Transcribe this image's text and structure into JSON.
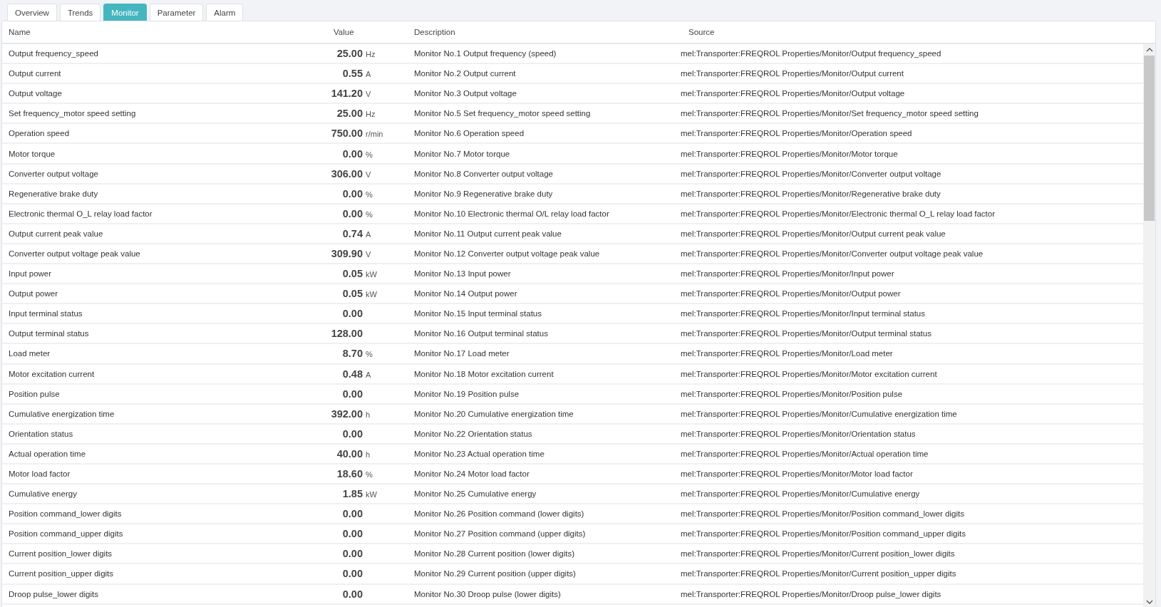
{
  "tabs": [
    {
      "label": "Overview",
      "selected": false
    },
    {
      "label": "Trends",
      "selected": false
    },
    {
      "label": "Monitor",
      "selected": true
    },
    {
      "label": "Parameter",
      "selected": false
    },
    {
      "label": "Alarm",
      "selected": false
    }
  ],
  "table": {
    "columns": [
      "Name",
      "Value",
      "Description",
      "Source"
    ],
    "rows": [
      {
        "name": "Output frequency_speed",
        "value": "25.00",
        "unit": "Hz",
        "description": "Monitor No.1 Output frequency (speed)",
        "source": "mel:Transporter:FREQROL Properties/Monitor/Output frequency_speed"
      },
      {
        "name": "Output current",
        "value": "0.55",
        "unit": "A",
        "description": "Monitor No.2 Output current",
        "source": "mel:Transporter:FREQROL Properties/Monitor/Output current"
      },
      {
        "name": "Output voltage",
        "value": "141.20",
        "unit": "V",
        "description": "Monitor No.3 Output voltage",
        "source": "mel:Transporter:FREQROL Properties/Monitor/Output voltage"
      },
      {
        "name": "Set frequency_motor speed setting",
        "value": "25.00",
        "unit": "Hz",
        "description": "Monitor No.5 Set frequency_motor speed setting",
        "source": "mel:Transporter:FREQROL Properties/Monitor/Set frequency_motor speed setting"
      },
      {
        "name": "Operation speed",
        "value": "750.00",
        "unit": "r/min",
        "description": "Monitor No.6 Operation speed",
        "source": "mel:Transporter:FREQROL Properties/Monitor/Operation speed"
      },
      {
        "name": "Motor torque",
        "value": "0.00",
        "unit": "%",
        "description": "Monitor No.7 Motor torque",
        "source": "mel:Transporter:FREQROL Properties/Monitor/Motor torque"
      },
      {
        "name": "Converter output voltage",
        "value": "306.00",
        "unit": "V",
        "description": "Monitor No.8 Converter output voltage",
        "source": "mel:Transporter:FREQROL Properties/Monitor/Converter output voltage"
      },
      {
        "name": "Regenerative brake duty",
        "value": "0.00",
        "unit": "%",
        "description": "Monitor No.9 Regenerative brake duty",
        "source": "mel:Transporter:FREQROL Properties/Monitor/Regenerative brake duty"
      },
      {
        "name": "Electronic thermal O_L relay load factor",
        "value": "0.00",
        "unit": "%",
        "description": "Monitor No.10 Electronic thermal O/L relay load factor",
        "source": "mel:Transporter:FREQROL Properties/Monitor/Electronic thermal O_L relay load factor"
      },
      {
        "name": "Output current peak value",
        "value": "0.74",
        "unit": "A",
        "description": "Monitor No.11 Output current peak value",
        "source": "mel:Transporter:FREQROL Properties/Monitor/Output current peak value"
      },
      {
        "name": "Converter output voltage peak value",
        "value": "309.90",
        "unit": "V",
        "description": "Monitor No.12 Converter output voltage peak value",
        "source": "mel:Transporter:FREQROL Properties/Monitor/Converter output voltage peak value"
      },
      {
        "name": "Input power",
        "value": "0.05",
        "unit": "kW",
        "description": "Monitor No.13 Input power",
        "source": "mel:Transporter:FREQROL Properties/Monitor/Input power"
      },
      {
        "name": "Output power",
        "value": "0.05",
        "unit": "kW",
        "description": "Monitor No.14 Output power",
        "source": "mel:Transporter:FREQROL Properties/Monitor/Output power"
      },
      {
        "name": "Input terminal status",
        "value": "0.00",
        "description": "Monitor No.15 Input terminal status",
        "source": "mel:Transporter:FREQROL Properties/Monitor/Input terminal status"
      },
      {
        "name": "Output terminal status",
        "value": "128.00",
        "description": "Monitor No.16 Output terminal status",
        "source": "mel:Transporter:FREQROL Properties/Monitor/Output terminal status"
      },
      {
        "name": "Load meter",
        "value": "8.70",
        "unit": "%",
        "description": "Monitor No.17 Load meter",
        "source": "mel:Transporter:FREQROL Properties/Monitor/Load meter"
      },
      {
        "name": "Motor excitation current",
        "value": "0.48",
        "unit": "A",
        "description": "Monitor No.18 Motor excitation current",
        "source": "mel:Transporter:FREQROL Properties/Monitor/Motor excitation current"
      },
      {
        "name": "Position pulse",
        "value": "0.00",
        "description": "Monitor No.19 Position pulse",
        "source": "mel:Transporter:FREQROL Properties/Monitor/Position pulse"
      },
      {
        "name": "Cumulative energization time",
        "value": "392.00",
        "unit": "h",
        "description": "Monitor No.20 Cumulative energization time",
        "source": "mel:Transporter:FREQROL Properties/Monitor/Cumulative energization time"
      },
      {
        "name": "Orientation status",
        "value": "0.00",
        "description": "Monitor No.22 Orientation status",
        "source": "mel:Transporter:FREQROL Properties/Monitor/Orientation status"
      },
      {
        "name": "Actual operation time",
        "value": "40.00",
        "unit": "h",
        "description": "Monitor No.23 Actual operation time",
        "source": "mel:Transporter:FREQROL Properties/Monitor/Actual operation time"
      },
      {
        "name": "Motor load factor",
        "value": "18.60",
        "unit": "%",
        "description": "Monitor No.24 Motor load factor",
        "source": "mel:Transporter:FREQROL Properties/Monitor/Motor load factor"
      },
      {
        "name": "Cumulative energy",
        "value": "1.85",
        "unit": "kW",
        "description": "Monitor No.25 Cumulative energy",
        "source": "mel:Transporter:FREQROL Properties/Monitor/Cumulative energy"
      },
      {
        "name": "Position command_lower digits",
        "value": "0.00",
        "description": "Monitor No.26 Position command (lower digits)",
        "source": "mel:Transporter:FREQROL Properties/Monitor/Position command_lower digits"
      },
      {
        "name": "Position command_upper digits",
        "value": "0.00",
        "description": "Monitor No.27 Position command (upper digits)",
        "source": "mel:Transporter:FREQROL Properties/Monitor/Position command_upper digits"
      },
      {
        "name": "Current position_lower digits",
        "value": "0.00",
        "description": "Monitor No.28 Current position (lower digits)",
        "source": "mel:Transporter:FREQROL Properties/Monitor/Current position_lower digits"
      },
      {
        "name": "Current position_upper digits",
        "value": "0.00",
        "description": "Monitor No.29 Current position (upper digits)",
        "source": "mel:Transporter:FREQROL Properties/Monitor/Current position_upper digits"
      },
      {
        "name": "Droop pulse_lower digits",
        "value": "0.00",
        "description": "Monitor No.30 Droop pulse (lower digits)",
        "source": "mel:Transporter:FREQROL Properties/Monitor/Droop pulse_lower digits"
      }
    ]
  }
}
